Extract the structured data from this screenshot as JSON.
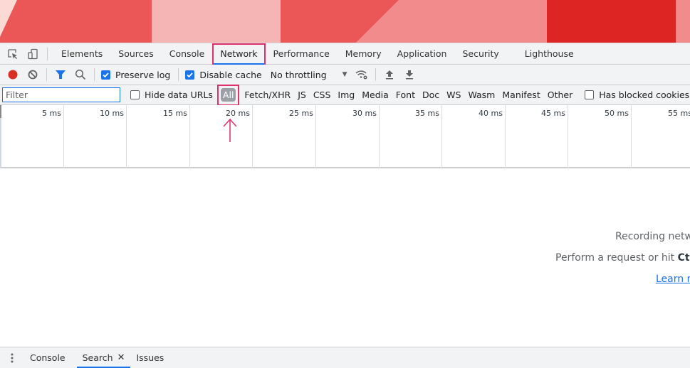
{
  "banner": {
    "colors": [
      "#fbd9d4",
      "#eb5757",
      "#f4b5b4",
      "#eb5757",
      "#f28b8b",
      "#dd2623",
      "#f28b8b"
    ]
  },
  "devtools": {
    "tabs": [
      {
        "label": "Elements"
      },
      {
        "label": "Sources"
      },
      {
        "label": "Console"
      },
      {
        "label": "Network",
        "active": true
      },
      {
        "label": "Performance"
      },
      {
        "label": "Memory"
      },
      {
        "label": "Application"
      },
      {
        "label": "Security"
      },
      {
        "label": "Lighthouse"
      }
    ],
    "toolbar": {
      "preserve_log": {
        "label": "Preserve log",
        "checked": true
      },
      "disable_cache": {
        "label": "Disable cache",
        "checked": true
      },
      "throttling": "No throttling"
    },
    "filterbar": {
      "filter_placeholder": "Filter",
      "filter_value": "",
      "hide_data_urls": {
        "label": "Hide data URLs",
        "checked": false
      },
      "types": [
        "All",
        "Fetch/XHR",
        "JS",
        "CSS",
        "Img",
        "Media",
        "Font",
        "Doc",
        "WS",
        "Wasm",
        "Manifest",
        "Other"
      ],
      "selected_type": "All",
      "has_blocked_cookies": {
        "label": "Has blocked cookies",
        "checked": false
      }
    },
    "overview": {
      "ticks": [
        "5 ms",
        "10 ms",
        "15 ms",
        "20 ms",
        "25 ms",
        "30 ms",
        "35 ms",
        "40 ms",
        "45 ms",
        "50 ms",
        "55 ms"
      ]
    },
    "empty_state": {
      "line1": "Recording netw",
      "line2_prefix": "Perform a request or hit ",
      "line2_bold": "Ctrl",
      "link": "Learn m"
    },
    "drawer": {
      "tabs": [
        {
          "label": "Console"
        },
        {
          "label": "Search",
          "active": true,
          "closable": true
        },
        {
          "label": "Issues"
        }
      ]
    },
    "colors": {
      "accent": "#1a73e8",
      "record": "#d93025",
      "highlight": "#e0306a"
    }
  }
}
